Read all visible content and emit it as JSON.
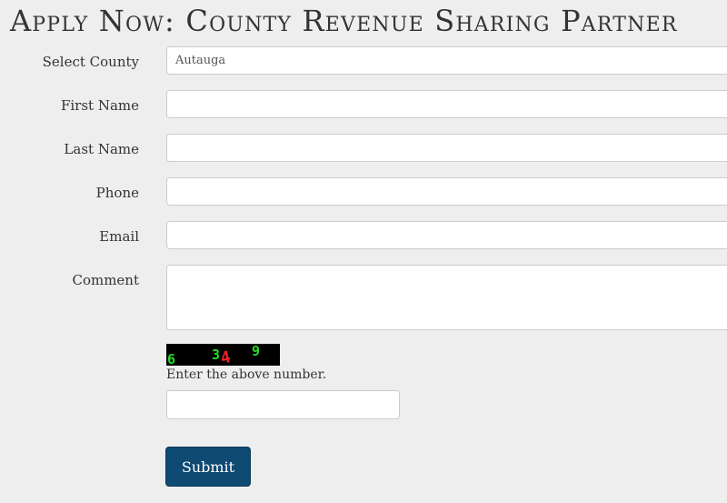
{
  "page": {
    "title": "Apply Now: County Revenue Sharing Partner"
  },
  "form": {
    "county": {
      "label": "Select County",
      "value": "Autauga"
    },
    "first_name": {
      "label": "First Name",
      "value": ""
    },
    "last_name": {
      "label": "Last Name",
      "value": ""
    },
    "phone": {
      "label": "Phone",
      "value": ""
    },
    "email": {
      "label": "Email",
      "value": ""
    },
    "comment": {
      "label": "Comment",
      "value": ""
    },
    "captcha": {
      "digits": [
        "6",
        "3",
        "4",
        "9"
      ],
      "digit_colors": [
        "#22dd22",
        "#22dd22",
        "#ee2222",
        "#22dd22"
      ],
      "hint": "Enter the above number.",
      "value": ""
    },
    "submit_label": "Submit"
  },
  "colors": {
    "background": "#eeeeee",
    "submit_button": "#0f4a73",
    "field_border": "#cccccc"
  }
}
